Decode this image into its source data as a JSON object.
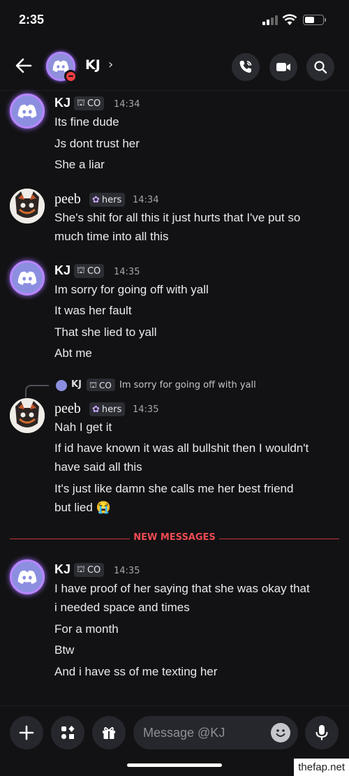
{
  "status": {
    "time": "2:35"
  },
  "header": {
    "title": "KJ",
    "chevron": "›"
  },
  "icons": {
    "back": "arrow-left-icon",
    "call": "phone-icon",
    "video": "video-camera-icon",
    "search": "search-icon",
    "plus": "plus-icon",
    "apps": "apps-icon",
    "gift": "gift-icon",
    "emoji": "emoji-icon",
    "mic": "microphone-icon"
  },
  "messages": [
    {
      "author": "KJ",
      "tag": "CO",
      "time": "14:34",
      "lines": [
        "Its fine dude",
        "Js dont trust her",
        "She a liar"
      ]
    },
    {
      "author": "peeb",
      "tag": "hers",
      "time": "14:34",
      "lines": [
        "She's shit for all this it just hurts that I've put so",
        "much time into all this"
      ]
    },
    {
      "author": "KJ",
      "tag": "CO",
      "time": "14:35",
      "lines": [
        "Im sorry for going off with yall",
        "It was her fault",
        "That she lied to yall",
        "Abt me"
      ]
    },
    {
      "author": "peeb",
      "tag": "hers",
      "time": "14:35",
      "reply": {
        "author": "KJ",
        "tag": "CO",
        "text": "Im sorry for going off with yall"
      },
      "lines": [
        "Nah I get it",
        "If id have known it was all bullshit then I wouldn't",
        "have said all this",
        "It's just like damn she calls me her best friend",
        "but lied 😭"
      ]
    },
    {
      "author": "KJ",
      "tag": "CO",
      "time": "14:35",
      "lines": [
        "I have proof of her saying that she was okay that",
        "i needed space and times",
        "For a month",
        "Btw",
        "And i have ss of me texting her"
      ]
    }
  ],
  "divider": {
    "label": "NEW MESSAGES",
    "color": "#f04a52"
  },
  "composer": {
    "placeholder": "Message @KJ"
  },
  "watermark": "thefap.net",
  "colors": {
    "background": "#121214",
    "tag_bg": "#2b2d33",
    "avatar_ring": "#b986ff"
  }
}
